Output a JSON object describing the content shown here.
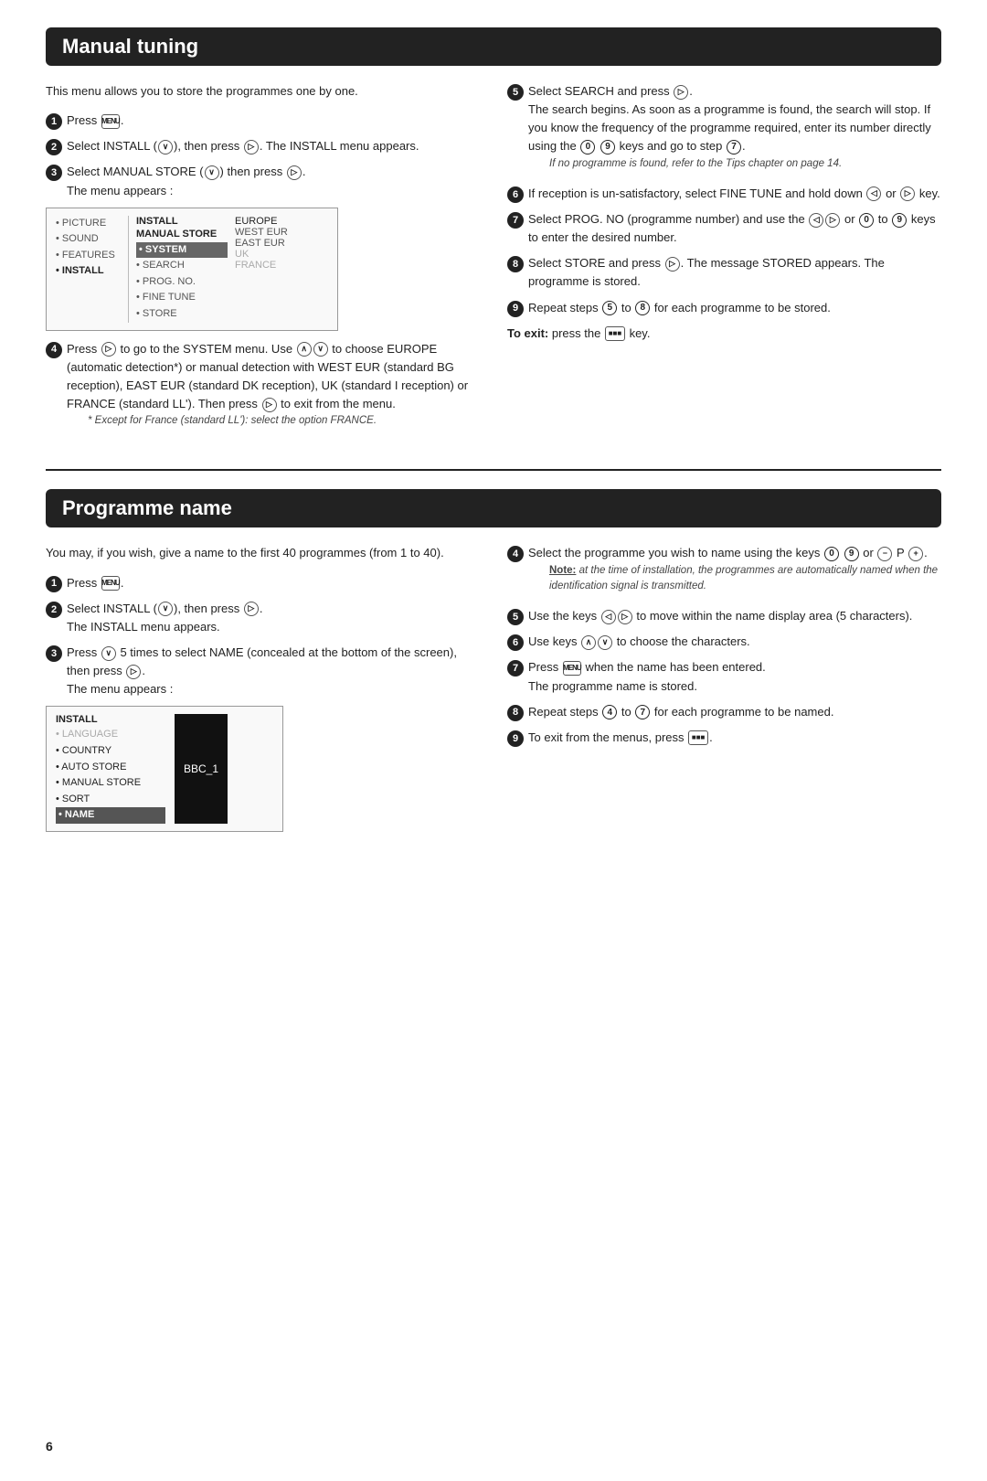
{
  "section1": {
    "title": "Manual tuning",
    "intro": "This menu allows you to store the programmes one by one.",
    "left_steps": [
      {
        "num": "1",
        "text": "Press"
      },
      {
        "num": "2",
        "text": "Select INSTALL, then press ▷. The INSTALL menu appears."
      },
      {
        "num": "3",
        "text": "Select MANUAL STORE then press ▷. The menu appears :"
      },
      {
        "num": "4",
        "text": "Press ▷ to go to the SYSTEM menu. Use ∧∨ to choose EUROPE (automatic detection*) or manual detection with WEST EUR (standard BG reception), EAST EUR (standard DK reception), UK (standard I reception) or FRANCE (standard LL'). Then press ▷ to exit from the menu.",
        "note": "* Except for France (standard LL'): select the option FRANCE."
      }
    ],
    "right_steps": [
      {
        "num": "5",
        "text": "Select SEARCH and press ▷. The search begins. As soon as a programme is found, the search will stop. If you know the frequency of the programme required, enter its number directly using the 0 9 keys and go to step 7.",
        "note": "If no programme is found, refer to the Tips chapter on page 14."
      },
      {
        "num": "6",
        "text": "If reception is un-satisfactory, select FINE TUNE and hold down ◁ or ▷ key."
      },
      {
        "num": "7",
        "text": "Select PROG. NO (programme number) and use the ◁▷ or 0 to 9 keys to enter the desired number."
      },
      {
        "num": "8",
        "text": "Select STORE and press ▷. The message STORED appears. The programme is stored."
      },
      {
        "num": "9",
        "text": "Repeat steps 5 to 8 for each programme to be stored."
      }
    ],
    "exit_text": "To exit: press the",
    "exit_key": "key."
  },
  "section2": {
    "title": "Programme name",
    "intro": "You may, if you wish, give a name to the first 40 programmes (from 1 to 40).",
    "left_steps": [
      {
        "num": "1",
        "text": "Press"
      },
      {
        "num": "2",
        "text": "Select INSTALL, then press ▷. The INSTALL menu appears."
      },
      {
        "num": "3",
        "text": "Press ∨ 5 times to select NAME (concealed at the bottom of the screen), then press ▷. The menu appears :"
      }
    ],
    "right_steps": [
      {
        "num": "4",
        "text": "Select the programme you wish to name using the keys 0 9 or − P +.",
        "note": "Note: at the time of installation, the programmes are automatically named when the identification signal is transmitted."
      },
      {
        "num": "5",
        "text": "Use the keys ◁▷ to move within the name display area (5 characters)."
      },
      {
        "num": "6",
        "text": "Use keys ∧∨ to choose the characters."
      },
      {
        "num": "7",
        "text": "Press MENU when the name has been entered. The programme name is stored."
      },
      {
        "num": "8",
        "text": "Repeat steps 4 to 7 for each programme to be named."
      },
      {
        "num": "9",
        "text": "To exit from the menus, press"
      }
    ]
  },
  "menu1": {
    "sidebar": [
      "PICTURE",
      "SOUND",
      "FEATURES",
      "INSTALL"
    ],
    "main_header": "INSTALL",
    "main_subheader": "MANUAL STORE",
    "main_items": [
      "SYSTEM",
      "SEARCH",
      "PROG. NO.",
      "FINE TUNE",
      "STORE"
    ],
    "right_col": [
      "EUROPE",
      "WEST EUR",
      "EAST EUR",
      "UK",
      "FRANCE"
    ]
  },
  "menu2": {
    "header": "INSTALL",
    "items": [
      "LANGUAGE",
      "COUNTRY",
      "AUTO STORE",
      "MANUAL STORE",
      "SORT",
      "NAME"
    ],
    "value_label": "BBC_1"
  },
  "page_number": "6"
}
